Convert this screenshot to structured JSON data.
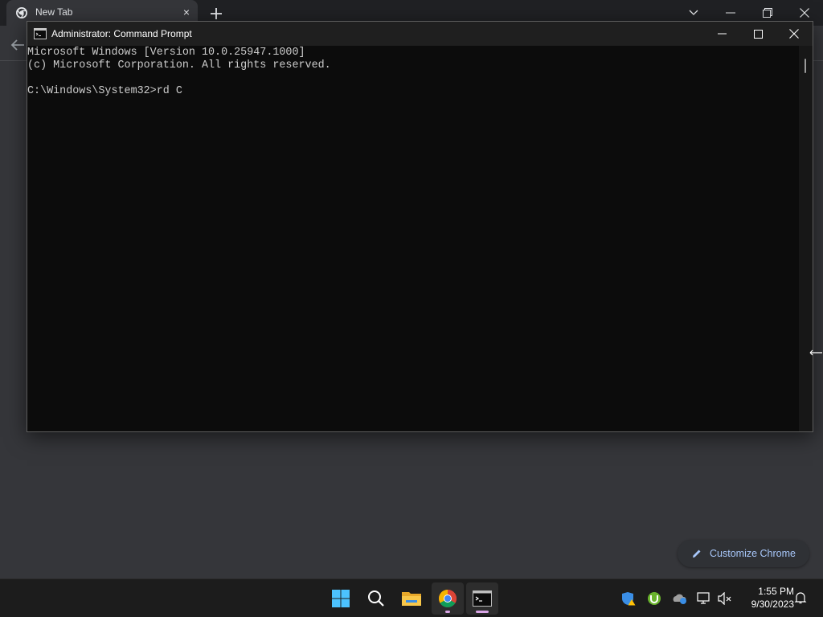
{
  "browser": {
    "tab_title": "New Tab",
    "tab_close_glyph": "×",
    "new_tab_icon": "plus-icon",
    "controls": [
      "tab-search-icon",
      "minimize-icon",
      "restore-icon",
      "close-icon"
    ],
    "back_icon": "arrow-left-icon",
    "customize_label": "Customize Chrome",
    "customize_icon": "pencil-icon",
    "link_color": "#a8c7fa"
  },
  "cmd": {
    "title": "Administrator: Command Prompt",
    "lines": [
      "Microsoft Windows [Version 10.0.25947.1000]",
      "(c) Microsoft Corporation. All rights reserved.",
      "",
      "C:\\Windows\\System32>rd C"
    ],
    "text_color": "#cccccc",
    "background": "#0c0c0c"
  },
  "taskbar": {
    "apps": [
      "windows-start-icon",
      "search-icon",
      "file-explorer-icon",
      "chrome-icon",
      "terminal-icon"
    ],
    "tray": [
      "defender-warning-icon",
      "utorrent-icon",
      "onedrive-icon",
      "network-icon",
      "volume-muted-icon"
    ],
    "time": "1:55 PM",
    "date": "9/30/2023",
    "notification_icon": "bell-icon"
  }
}
